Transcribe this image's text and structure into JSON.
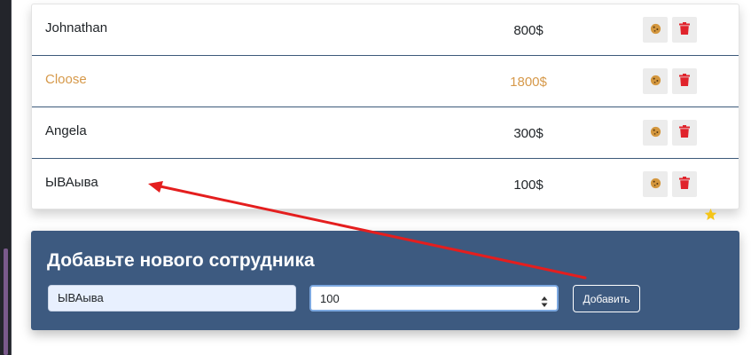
{
  "employees": [
    {
      "name": "Johnathan",
      "salary": "800$",
      "highlighted": false
    },
    {
      "name": "Cloose",
      "salary": "1800$",
      "highlighted": true
    },
    {
      "name": "Angela",
      "salary": "300$",
      "highlighted": false
    },
    {
      "name": "ЫВАыва",
      "salary": "100$",
      "highlighted": false
    }
  ],
  "row_actions": {
    "cookie_icon": "cookie-icon",
    "trash_icon": "trash-icon"
  },
  "form": {
    "title": "Добавьте нового сотрудника",
    "name_value": "ЫВАыва",
    "salary_value": "100",
    "submit_label": "Добавить"
  },
  "colors": {
    "highlight": "#d6994a",
    "panel": "#3d5a80",
    "row_divider": "#3d5a7a",
    "delete": "#e0232b",
    "cookie": "#d4973e",
    "annotation_arrow": "#e41e1e",
    "star": "#f5c518"
  },
  "icons": {
    "star": "star-icon",
    "spinner": "spinner-icon"
  }
}
